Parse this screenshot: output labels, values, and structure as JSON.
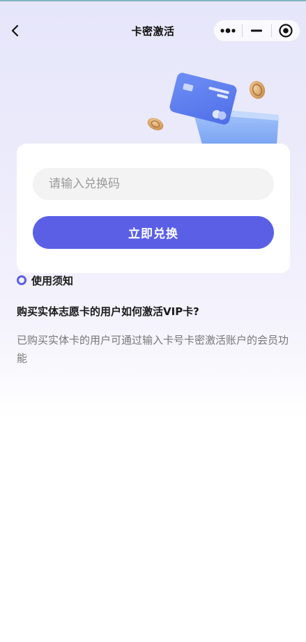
{
  "nav": {
    "title": "卡密激活",
    "back_icon": "chevron-left-icon",
    "capsule": {
      "more_icon": "more-dots-icon",
      "minimize_icon": "minimize-icon",
      "close_icon": "target-circle-icon"
    }
  },
  "illustration": {
    "icon": "card-coins-illustration",
    "colors": {
      "card": "#5b7cf0",
      "pocket": "#8fb4f7",
      "coin": "#d9a56a"
    }
  },
  "redeem": {
    "input_placeholder": "请输入兑换码",
    "input_value": "",
    "button_label": "立即兑换"
  },
  "notice": {
    "title": "使用须知",
    "question": "购买实体志愿卡的用户如何激活VIP卡?",
    "answer": "已购买实体卡的用户可通过输入卡号卡密激活账户的会员功能"
  },
  "colors": {
    "accent": "#5b5fe6",
    "background_top": "#e6e6fb"
  }
}
